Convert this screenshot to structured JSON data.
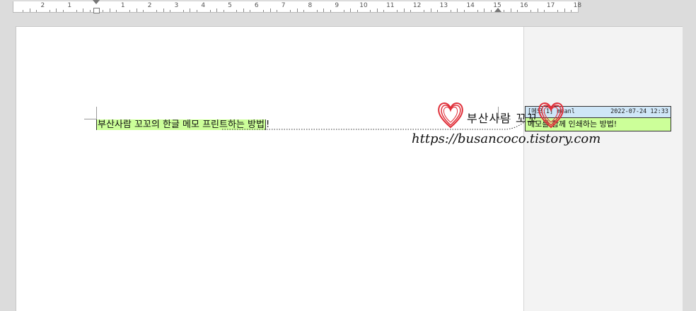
{
  "ruler": {
    "labels": [
      "2",
      "1",
      "1",
      "2",
      "3",
      "4",
      "5",
      "6",
      "7",
      "8",
      "9",
      "10",
      "11",
      "12",
      "13",
      "14",
      "15",
      "16",
      "17",
      "18"
    ]
  },
  "document": {
    "body_text_highlighted": "부산사람 꼬꼬의 한글 메모 프린트하는 방법",
    "body_text_trailing": "!"
  },
  "memo": {
    "label": "[메모:1] meanl",
    "date": "2022-07-24 12:33",
    "content": "메모를 함께 인쇄하는 방법!",
    "color": "#ccff99",
    "header_color": "#cfe6f7"
  },
  "watermark": {
    "title": "부산사람 꼬꼬",
    "url": "https://busancoco.tistory.com",
    "heart_color": "#e0303a"
  }
}
